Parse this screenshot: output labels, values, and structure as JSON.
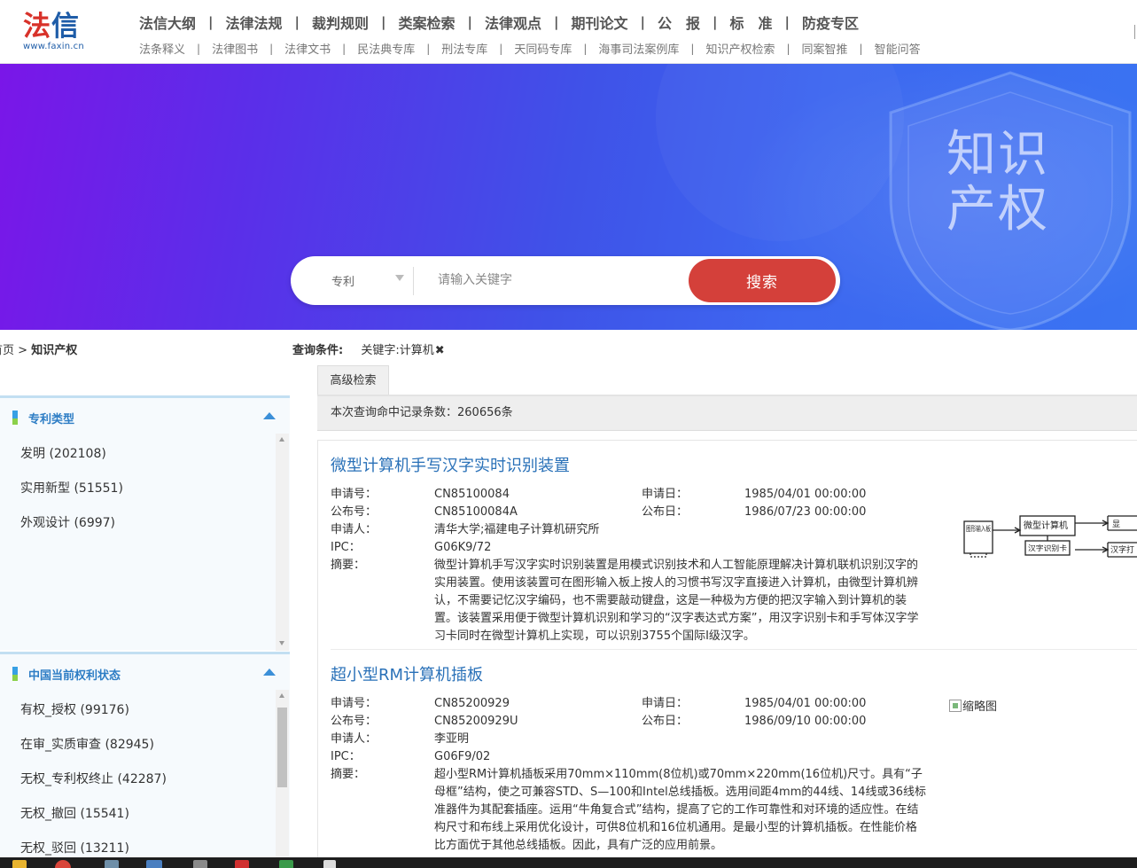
{
  "logo": {
    "char1": "法",
    "char2": "信",
    "url": "www.faxin.cn"
  },
  "nav_primary": [
    "法信大纲",
    "法律法规",
    "裁判规则",
    "类案检索",
    "法律观点",
    "期刊论文",
    "公　报",
    "标　准",
    "防疫专区"
  ],
  "nav_secondary": [
    "法条释义",
    "法律图书",
    "法律文书",
    "民法典专库",
    "刑法专库",
    "天同码专库",
    "海事司法案例库",
    "知识产权检索",
    "同案智推",
    "智能问答"
  ],
  "nav_separator": "|",
  "banner": {
    "line1": "知识",
    "line2": "产权"
  },
  "search": {
    "type_value": "专利",
    "placeholder": "请输入关键字",
    "button_label": "搜索"
  },
  "breadcrumb": {
    "home": "首页",
    "sep": ">",
    "current": "知识产权"
  },
  "conditions": {
    "label": "查询条件:",
    "keyword": "关键字:计算机",
    "remove": "✖"
  },
  "filters": [
    {
      "title": "专利类型",
      "items": [
        "发明 (202108)",
        "实用新型 (51551)",
        "外观设计 (6997)"
      ]
    },
    {
      "title": "中国当前权利状态",
      "items": [
        "有权_授权 (99176)",
        "在审_实质审查 (82945)",
        "无权_专利权终止 (42287)",
        "无权_撤回 (15541)",
        "无权_驳回 (13211)"
      ]
    }
  ],
  "results_tab": "高级检索",
  "record_count": "本次查询命中记录条数：260656条",
  "labels": {
    "app_no": "申请号：",
    "pub_no": "公布号：",
    "applicant": "申请人：",
    "ipc": "IPC：",
    "abstract": "摘要：",
    "app_date": "申请日：",
    "pub_date": "公布日："
  },
  "results": [
    {
      "title": "微型计算机手写汉字实时识别装置",
      "app_no": "CN85100084",
      "pub_no": "CN85100084A",
      "applicant": "清华大学;福建电子计算机研究所",
      "ipc": "G06K9/72",
      "app_date": "1985/04/01 00:00:00",
      "pub_date": "1986/07/23 00:00:00",
      "abstract": "微型计算机手写汉字实时识别装置是用模式识别技术和人工智能原理解决计算机联机识别汉字的实用装置。使用该装置可在图形输入板上按人的习惯书写汉字直接进入计算机，由微型计算机辨认，不需要记忆汉字编码，也不需要敲动键盘，这是一种极为方便的把汉字输入到计算机的装置。该装置采用便于微型计算机识别和学习的“汉字表达式方案”，用汉字识别卡和手写体汉字学习卡同时在微型计算机上实现，可以识别3755个国际I级汉字。",
      "diagram": {
        "box1": "图形输入板",
        "box2": "微型计算机",
        "box3": "汉字识别卡",
        "box4": "显",
        "box5": "汉字打"
      }
    },
    {
      "title": "超小型RM计算机插板",
      "app_no": "CN85200929",
      "pub_no": "CN85200929U",
      "applicant": "李亚明",
      "ipc": "G06F9/02",
      "app_date": "1985/04/01 00:00:00",
      "pub_date": "1986/09/10 00:00:00",
      "abstract": "超小型RM计算机插板采用70mm×110mm(8位机)或70mm×220mm(16位机)尺寸。具有“子母框”结构，使之可兼容STD、S—100和Intel总线插板。选用间距4mm的44线、14线或36线标准器件为其配套插座。运用“牛角复合式”结构，提高了它的工作可靠性和对环境的适应性。在结构尺寸和布线上采用优化设计，可供8位机和16位机通用。是最小型的计算机插板。在性能价格比方面优于其他总线插板。因此，具有广泛的应用前景。",
      "thumbnail_alt": "缩略图"
    }
  ]
}
